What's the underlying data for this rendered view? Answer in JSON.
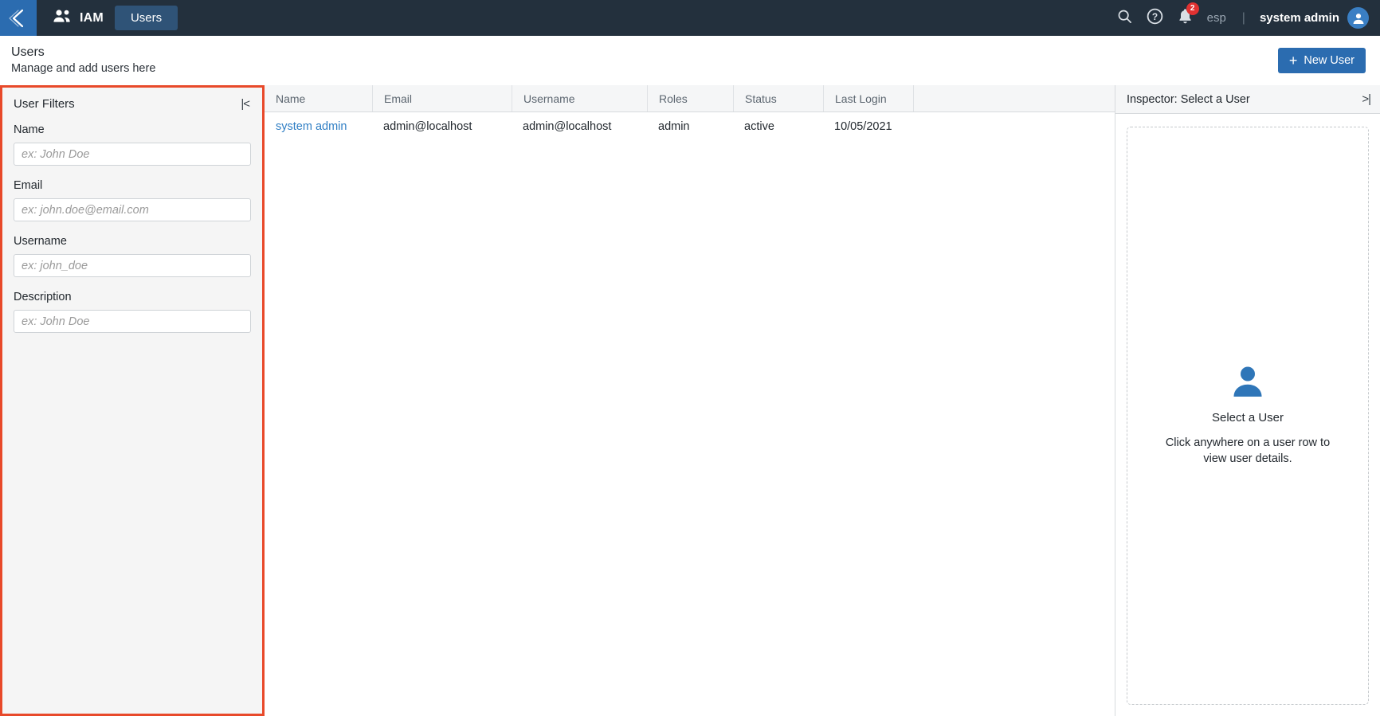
{
  "topnav": {
    "back_icon": "chevron-left-icon",
    "brand_icon": "people-icon",
    "brand_label": "IAM",
    "tabs": [
      {
        "label": "Users",
        "active": true
      }
    ],
    "search_icon": "search-icon",
    "help_icon": "help-circle-icon",
    "notifications_icon": "bell-icon",
    "notifications_count": "2",
    "language": "esp",
    "separator": "|",
    "user_name": "system admin",
    "avatar_icon": "user-avatar-icon"
  },
  "page_header": {
    "title": "Users",
    "subtitle": "Manage and add users here",
    "new_user_label": "New User",
    "new_user_plus": "+"
  },
  "filters": {
    "title": "User Filters",
    "collapse_icon": "collapse-left-icon",
    "collapse_glyph": "|<",
    "fields": [
      {
        "label": "Name",
        "value": "",
        "placeholder": "ex: John Doe"
      },
      {
        "label": "Email",
        "value": "",
        "placeholder": "ex: john.doe@email.com"
      },
      {
        "label": "Username",
        "value": "",
        "placeholder": "ex: john_doe"
      },
      {
        "label": "Description",
        "value": "",
        "placeholder": "ex: John Doe"
      }
    ]
  },
  "table": {
    "columns": [
      "Name",
      "Email",
      "Username",
      "Roles",
      "Status",
      "Last Login"
    ],
    "rows": [
      {
        "name": "system admin",
        "email": "admin@localhost",
        "username": "admin@localhost",
        "roles": "admin",
        "status": "active",
        "last_login": "10/05/2021"
      }
    ]
  },
  "inspector": {
    "title": "Inspector: Select a User",
    "collapse_icon": "collapse-right-icon",
    "collapse_glyph": ">|",
    "empty_icon": "user-icon",
    "empty_title": "Select a User",
    "empty_desc": "Click anywhere on a user row to view user details."
  },
  "colors": {
    "nav_bg": "#23303d",
    "accent_blue": "#2b6cb0",
    "link_blue": "#2f7ec4",
    "highlight_red": "#e8492a",
    "badge_red": "#e03131",
    "panel_bg": "#f5f5f5"
  }
}
